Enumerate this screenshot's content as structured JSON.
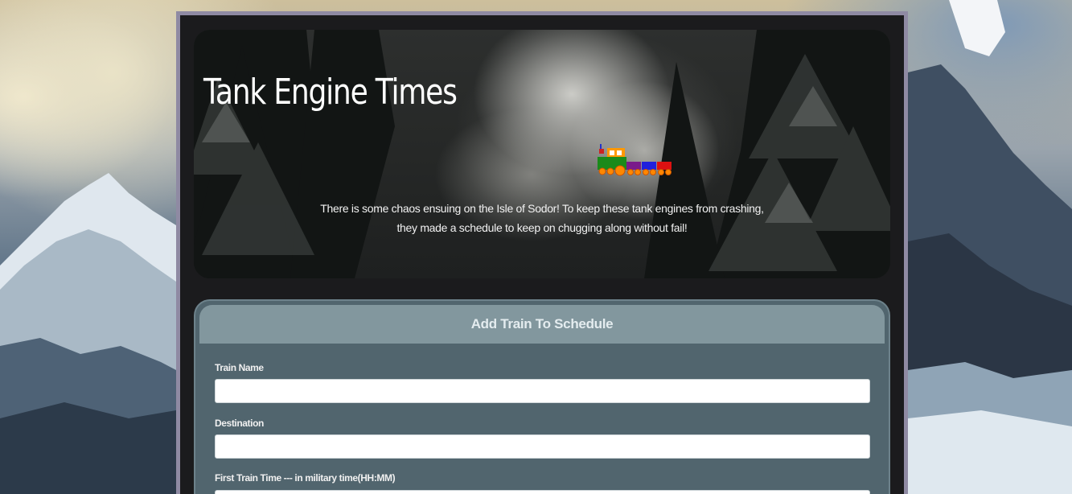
{
  "header": {
    "title": "Tank Engine Times",
    "tagline_line1": "There is some chaos ensuing on the Isle of Sodor! To keep these tank engines from crashing,",
    "tagline_line2": "they made a schedule to keep on chugging along without fail!",
    "train_icon": "train-icon"
  },
  "form": {
    "heading": "Add Train To Schedule",
    "fields": [
      {
        "label": "Train Name",
        "value": "",
        "placeholder": ""
      },
      {
        "label": "Destination",
        "value": "",
        "placeholder": ""
      },
      {
        "label": "First Train Time --- in military time(HH:MM)",
        "value": "",
        "placeholder": ""
      }
    ]
  },
  "colors": {
    "frame_border": "#8f8aa3",
    "panel_bg": "#51656e",
    "panel_heading_bg": "#82979e",
    "title_text": "#ffffff"
  }
}
